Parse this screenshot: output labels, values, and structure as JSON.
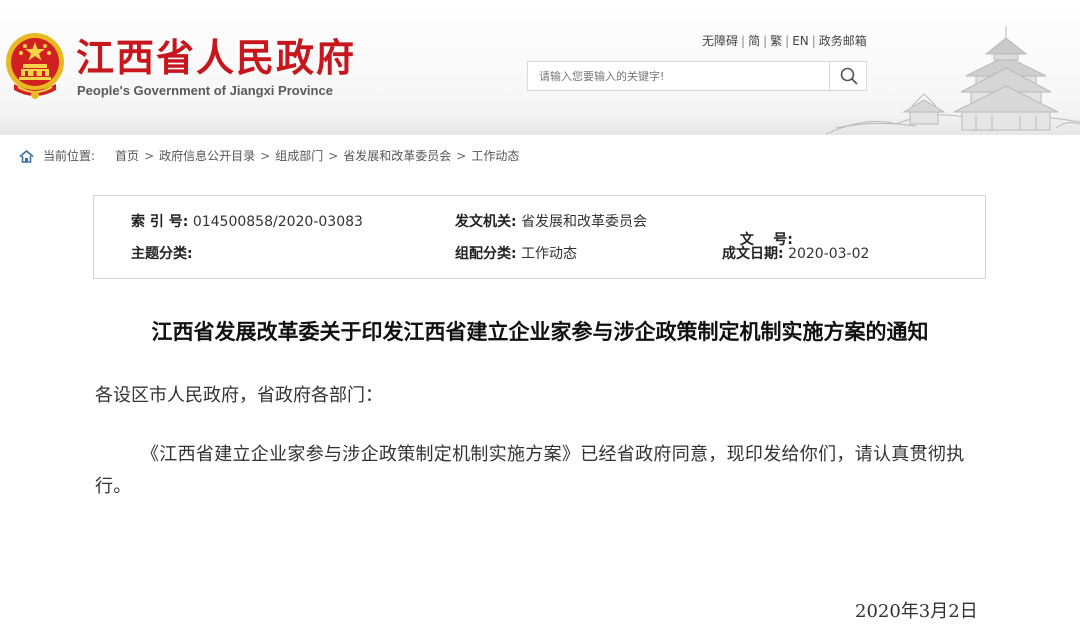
{
  "header": {
    "site_title": "江西省人民政府",
    "site_subtitle": "People's Government of Jiangxi Province",
    "links": [
      "无障碍",
      "简",
      "繁",
      "EN",
      "政务邮箱"
    ],
    "search_placeholder": "请输入您要输入的关键字!"
  },
  "breadcrumb": {
    "label": "当前位置:",
    "items": [
      "首页",
      "政府信息公开目录",
      "组成部门",
      "省发展和改革委员会",
      "工作动态"
    ],
    "separator": ">"
  },
  "meta": {
    "index_label": "索 引 号:",
    "index_value": "014500858/2020-03083",
    "issuer_label": "发文机关:",
    "issuer_value": "省发展和改革委员会",
    "docno_label": "文    号:",
    "docno_value": "",
    "topic_label": "主题分类:",
    "topic_value": "",
    "group_label": "组配分类:",
    "group_value": "工作动态",
    "date_label": "成文日期:",
    "date_value": "2020-03-02"
  },
  "article": {
    "title": "江西省发展改革委关于印发江西省建立企业家参与涉企政策制定机制实施方案的通知",
    "salutation": "各设区市人民政府，省政府各部门：",
    "body": "《江西省建立企业家参与涉企政策制定机制实施方案》已经省政府同意，现印发给你们，请认真贯彻执行。",
    "date": "2020年3月2日"
  },
  "colors": {
    "brand_red": "#c8161d",
    "emblem_gold": "#e8b923"
  }
}
